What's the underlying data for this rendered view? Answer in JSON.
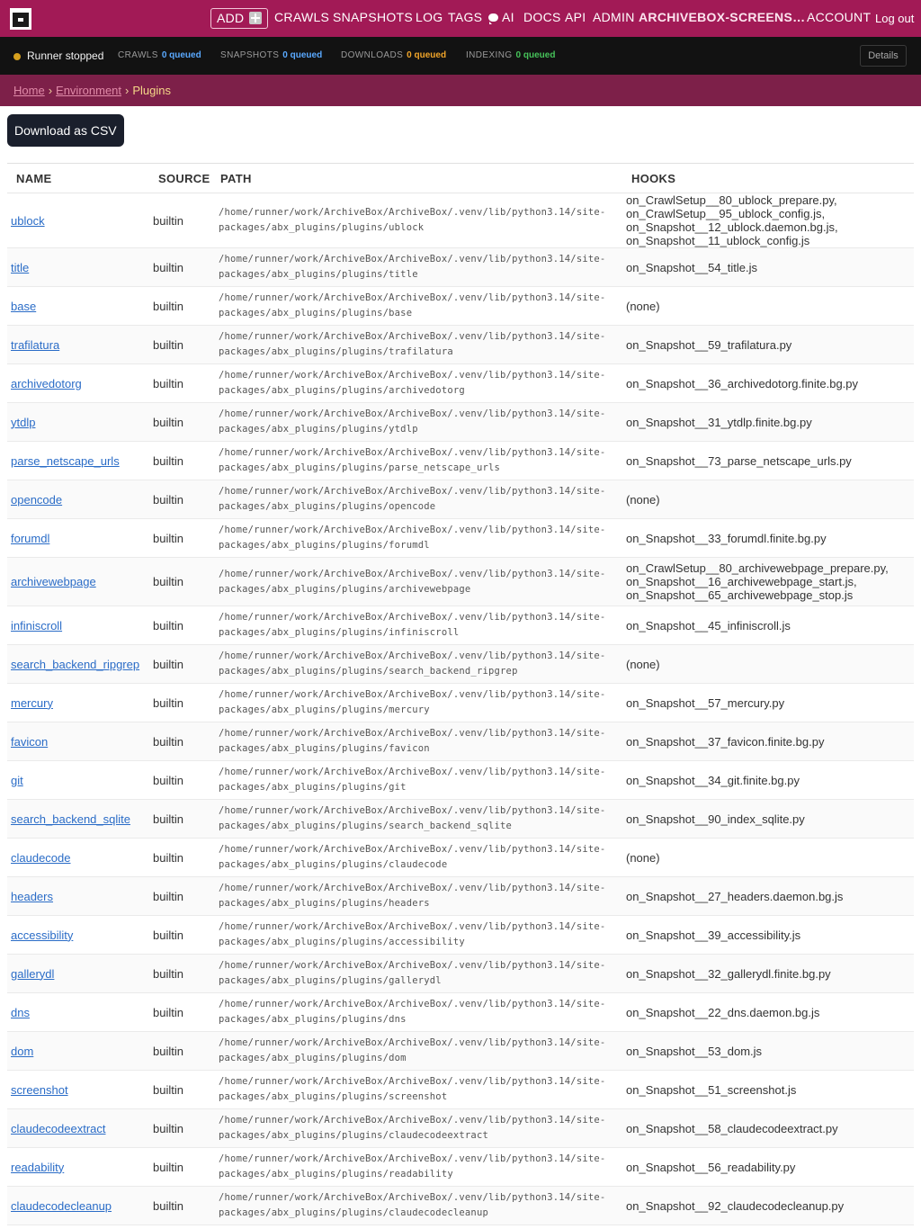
{
  "nav": {
    "add_label": "ADD",
    "links": [
      "CRAWLS",
      "SNAPSHOTS",
      "LOG",
      "TAGS",
      "AI",
      "DOCS",
      "API",
      "ADMIN"
    ],
    "site_name": "ARCHIVEBOX-SCREENS…",
    "account": "ACCOUNT",
    "logout": "Log out"
  },
  "status": {
    "runner": "Runner stopped",
    "crawls_label": "CRAWLS",
    "crawls_value": "0 queued",
    "snapshots_label": "SNAPSHOTS",
    "snapshots_value": "0 queued",
    "downloads_label": "DOWNLOADS",
    "downloads_value": "0 queued",
    "indexing_label": "INDEXING",
    "indexing_value": "0 queued",
    "details": "Details",
    "colors": {
      "crawls": "#5aa9ff",
      "snapshots": "#5aa9ff",
      "downloads": "#f0a52a",
      "indexing": "#46c35a",
      "runner_dot": "#d6a01e"
    }
  },
  "breadcrumb": {
    "home": "Home",
    "environment": "Environment",
    "current": "Plugins",
    "sep": "›"
  },
  "main": {
    "csv_button": "Download as CSV",
    "columns": [
      "NAME",
      "SOURCE",
      "PATH",
      "HOOKS"
    ],
    "rows": [
      {
        "name": "ublock",
        "source": "builtin",
        "path": "/home/runner/work/ArchiveBox/ArchiveBox/.venv/lib/python3.14/site-packages/abx_plugins/plugins/ublock",
        "hooks": [
          "on_CrawlSetup__80_ublock_prepare.py,",
          "on_CrawlSetup__95_ublock_config.js,",
          "on_Snapshot__12_ublock.daemon.bg.js,",
          "on_Snapshot__11_ublock_config.js"
        ]
      },
      {
        "name": "title",
        "source": "builtin",
        "path": "/home/runner/work/ArchiveBox/ArchiveBox/.venv/lib/python3.14/site-packages/abx_plugins/plugins/title",
        "hooks": [
          "on_Snapshot__54_title.js"
        ]
      },
      {
        "name": "base",
        "source": "builtin",
        "path": "/home/runner/work/ArchiveBox/ArchiveBox/.venv/lib/python3.14/site-packages/abx_plugins/plugins/base",
        "hooks": [
          "(none)"
        ]
      },
      {
        "name": "trafilatura",
        "source": "builtin",
        "path": "/home/runner/work/ArchiveBox/ArchiveBox/.venv/lib/python3.14/site-packages/abx_plugins/plugins/trafilatura",
        "hooks": [
          "on_Snapshot__59_trafilatura.py"
        ]
      },
      {
        "name": "archivedotorg",
        "source": "builtin",
        "path": "/home/runner/work/ArchiveBox/ArchiveBox/.venv/lib/python3.14/site-packages/abx_plugins/plugins/archivedotorg",
        "hooks": [
          "on_Snapshot__36_archivedotorg.finite.bg.py"
        ]
      },
      {
        "name": "ytdlp",
        "source": "builtin",
        "path": "/home/runner/work/ArchiveBox/ArchiveBox/.venv/lib/python3.14/site-packages/abx_plugins/plugins/ytdlp",
        "hooks": [
          "on_Snapshot__31_ytdlp.finite.bg.py"
        ]
      },
      {
        "name": "parse_netscape_urls",
        "source": "builtin",
        "path": "/home/runner/work/ArchiveBox/ArchiveBox/.venv/lib/python3.14/site-packages/abx_plugins/plugins/parse_netscape_urls",
        "hooks": [
          "on_Snapshot__73_parse_netscape_urls.py"
        ]
      },
      {
        "name": "opencode",
        "source": "builtin",
        "path": "/home/runner/work/ArchiveBox/ArchiveBox/.venv/lib/python3.14/site-packages/abx_plugins/plugins/opencode",
        "hooks": [
          "(none)"
        ]
      },
      {
        "name": "forumdl",
        "source": "builtin",
        "path": "/home/runner/work/ArchiveBox/ArchiveBox/.venv/lib/python3.14/site-packages/abx_plugins/plugins/forumdl",
        "hooks": [
          "on_Snapshot__33_forumdl.finite.bg.py"
        ]
      },
      {
        "name": "archivewebpage",
        "source": "builtin",
        "path": "/home/runner/work/ArchiveBox/ArchiveBox/.venv/lib/python3.14/site-packages/abx_plugins/plugins/archivewebpage",
        "hooks": [
          "on_CrawlSetup__80_archivewebpage_prepare.py,",
          "on_Snapshot__16_archivewebpage_start.js,",
          "on_Snapshot__65_archivewebpage_stop.js"
        ]
      },
      {
        "name": "infiniscroll",
        "source": "builtin",
        "path": "/home/runner/work/ArchiveBox/ArchiveBox/.venv/lib/python3.14/site-packages/abx_plugins/plugins/infiniscroll",
        "hooks": [
          "on_Snapshot__45_infiniscroll.js"
        ]
      },
      {
        "name": "search_backend_ripgrep",
        "source": "builtin",
        "path": "/home/runner/work/ArchiveBox/ArchiveBox/.venv/lib/python3.14/site-packages/abx_plugins/plugins/search_backend_ripgrep",
        "hooks": [
          "(none)"
        ]
      },
      {
        "name": "mercury",
        "source": "builtin",
        "path": "/home/runner/work/ArchiveBox/ArchiveBox/.venv/lib/python3.14/site-packages/abx_plugins/plugins/mercury",
        "hooks": [
          "on_Snapshot__57_mercury.py"
        ]
      },
      {
        "name": "favicon",
        "source": "builtin",
        "path": "/home/runner/work/ArchiveBox/ArchiveBox/.venv/lib/python3.14/site-packages/abx_plugins/plugins/favicon",
        "hooks": [
          "on_Snapshot__37_favicon.finite.bg.py"
        ]
      },
      {
        "name": "git",
        "source": "builtin",
        "path": "/home/runner/work/ArchiveBox/ArchiveBox/.venv/lib/python3.14/site-packages/abx_plugins/plugins/git",
        "hooks": [
          "on_Snapshot__34_git.finite.bg.py"
        ]
      },
      {
        "name": "search_backend_sqlite",
        "source": "builtin",
        "path": "/home/runner/work/ArchiveBox/ArchiveBox/.venv/lib/python3.14/site-packages/abx_plugins/plugins/search_backend_sqlite",
        "hooks": [
          "on_Snapshot__90_index_sqlite.py"
        ]
      },
      {
        "name": "claudecode",
        "source": "builtin",
        "path": "/home/runner/work/ArchiveBox/ArchiveBox/.venv/lib/python3.14/site-packages/abx_plugins/plugins/claudecode",
        "hooks": [
          "(none)"
        ]
      },
      {
        "name": "headers",
        "source": "builtin",
        "path": "/home/runner/work/ArchiveBox/ArchiveBox/.venv/lib/python3.14/site-packages/abx_plugins/plugins/headers",
        "hooks": [
          "on_Snapshot__27_headers.daemon.bg.js"
        ]
      },
      {
        "name": "accessibility",
        "source": "builtin",
        "path": "/home/runner/work/ArchiveBox/ArchiveBox/.venv/lib/python3.14/site-packages/abx_plugins/plugins/accessibility",
        "hooks": [
          "on_Snapshot__39_accessibility.js"
        ]
      },
      {
        "name": "gallerydl",
        "source": "builtin",
        "path": "/home/runner/work/ArchiveBox/ArchiveBox/.venv/lib/python3.14/site-packages/abx_plugins/plugins/gallerydl",
        "hooks": [
          "on_Snapshot__32_gallerydl.finite.bg.py"
        ]
      },
      {
        "name": "dns",
        "source": "builtin",
        "path": "/home/runner/work/ArchiveBox/ArchiveBox/.venv/lib/python3.14/site-packages/abx_plugins/plugins/dns",
        "hooks": [
          "on_Snapshot__22_dns.daemon.bg.js"
        ]
      },
      {
        "name": "dom",
        "source": "builtin",
        "path": "/home/runner/work/ArchiveBox/ArchiveBox/.venv/lib/python3.14/site-packages/abx_plugins/plugins/dom",
        "hooks": [
          "on_Snapshot__53_dom.js"
        ]
      },
      {
        "name": "screenshot",
        "source": "builtin",
        "path": "/home/runner/work/ArchiveBox/ArchiveBox/.venv/lib/python3.14/site-packages/abx_plugins/plugins/screenshot",
        "hooks": [
          "on_Snapshot__51_screenshot.js"
        ]
      },
      {
        "name": "claudecodeextract",
        "source": "builtin",
        "path": "/home/runner/work/ArchiveBox/ArchiveBox/.venv/lib/python3.14/site-packages/abx_plugins/plugins/claudecodeextract",
        "hooks": [
          "on_Snapshot__58_claudecodeextract.py"
        ]
      },
      {
        "name": "readability",
        "source": "builtin",
        "path": "/home/runner/work/ArchiveBox/ArchiveBox/.venv/lib/python3.14/site-packages/abx_plugins/plugins/readability",
        "hooks": [
          "on_Snapshot__56_readability.py"
        ]
      },
      {
        "name": "claudecodecleanup",
        "source": "builtin",
        "path": "/home/runner/work/ArchiveBox/ArchiveBox/.venv/lib/python3.14/site-packages/abx_plugins/plugins/claudecodecleanup",
        "hooks": [
          "on_Snapshot__92_claudecodecleanup.py"
        ]
      }
    ]
  }
}
